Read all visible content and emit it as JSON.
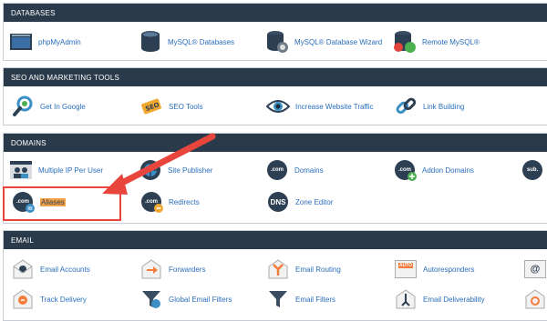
{
  "databases": {
    "title": "DATABASES",
    "items": [
      {
        "label": "phpMyAdmin",
        "icon": "phpmyadmin-icon"
      },
      {
        "label": "MySQL® Databases",
        "icon": "mysql-databases-icon"
      },
      {
        "label": "MySQL® Database Wizard",
        "icon": "mysql-wizard-icon"
      },
      {
        "label": "Remote MySQL®",
        "icon": "remote-mysql-icon"
      }
    ]
  },
  "seo": {
    "title": "SEO AND MARKETING TOOLS",
    "items": [
      {
        "label": "Get In Google",
        "icon": "google-search-icon"
      },
      {
        "label": "SEO Tools",
        "icon": "seo-tools-icon"
      },
      {
        "label": "Increase Website Traffic",
        "icon": "eye-icon"
      },
      {
        "label": "Link Building",
        "icon": "link-icon"
      }
    ]
  },
  "domains": {
    "title": "DOMAINS",
    "items": [
      {
        "label": "Multiple IP Per User",
        "icon": "multiple-ip-icon"
      },
      {
        "label": "Site Publisher",
        "icon": "site-publisher-icon"
      },
      {
        "label": "Domains",
        "icon": "domains-icon",
        "badge": ".com"
      },
      {
        "label": "Addon Domains",
        "icon": "addon-domains-icon",
        "badge": ".com"
      },
      {
        "label": "",
        "icon": "subdomains-icon",
        "badge": "sub."
      },
      {
        "label": "Aliases",
        "icon": "aliases-icon",
        "badge": ".com"
      },
      {
        "label": "Redirects",
        "icon": "redirects-icon",
        "badge": ".com"
      },
      {
        "label": "Zone Editor",
        "icon": "zone-editor-icon",
        "badge": "DNS"
      }
    ]
  },
  "email": {
    "title": "EMAIL",
    "items": [
      {
        "label": "Email Accounts",
        "icon": "email-accounts-icon"
      },
      {
        "label": "Forwarders",
        "icon": "forwarders-icon"
      },
      {
        "label": "Email Routing",
        "icon": "email-routing-icon"
      },
      {
        "label": "Autoresponders",
        "icon": "autoresponders-icon",
        "badge": "AUTO"
      },
      {
        "label": "",
        "icon": "default-address-icon",
        "badge": "@"
      },
      {
        "label": "Track Delivery",
        "icon": "track-delivery-icon"
      },
      {
        "label": "Global Email Filters",
        "icon": "global-filters-icon"
      },
      {
        "label": "Email Filters",
        "icon": "email-filters-icon"
      },
      {
        "label": "Email Deliverability",
        "icon": "email-deliverability-icon"
      },
      {
        "label": "",
        "icon": "encryption-icon"
      }
    ]
  },
  "colors": {
    "header_bg": "#2b3a4a",
    "link": "#2a6ebb",
    "highlight": "#f4a24a",
    "annotation_red": "#e8453c"
  }
}
